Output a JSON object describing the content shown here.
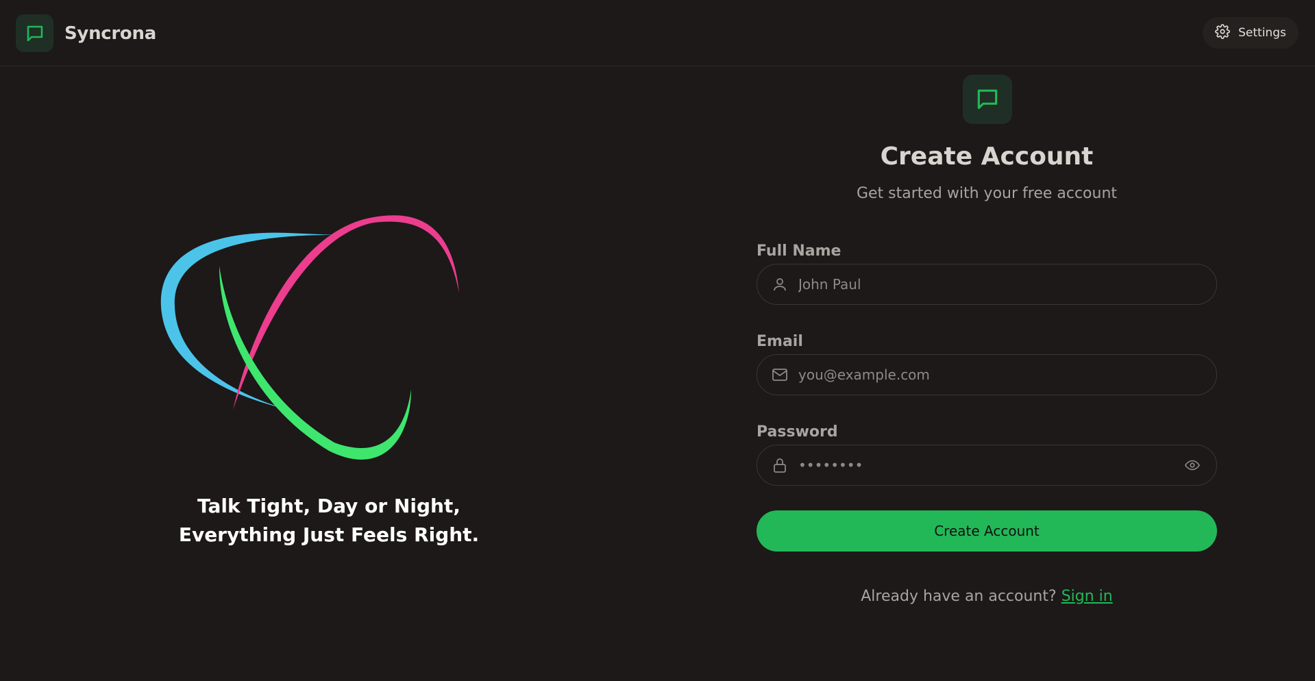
{
  "app": {
    "name": "Syncrona",
    "brand_icon": "chat-bubble-icon",
    "accent": "#22b858",
    "background": "#1c1918"
  },
  "header": {
    "settings_label": "Settings",
    "settings_icon": "gear-icon"
  },
  "hero": {
    "tagline_line1": "Talk Tight, Day or Night,",
    "tagline_line2": "Everything Just Feels Right.",
    "orbit_colors": [
      "#4cc4ea",
      "#ec3d8e",
      "#3ee66e"
    ]
  },
  "form": {
    "title": "Create Account",
    "subtitle": "Get started with your free account",
    "full_name": {
      "label": "Full Name",
      "placeholder": "John Paul",
      "value": "",
      "icon": "user-icon"
    },
    "email": {
      "label": "Email",
      "placeholder": "you@example.com",
      "value": "",
      "icon": "mail-icon"
    },
    "password": {
      "label": "Password",
      "placeholder": "••••••••",
      "value": "",
      "icon": "lock-icon",
      "toggle_icon": "eye-icon"
    },
    "submit_label": "Create Account",
    "signin_prompt": "Already have an account?",
    "signin_link": "Sign in"
  }
}
